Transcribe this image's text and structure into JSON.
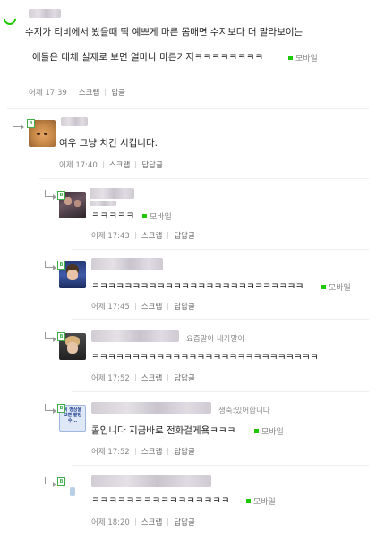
{
  "post": {
    "line1": "수지가 티비에서 봤을때 딱 예쁘게 마른 몸매면 수지보다 더 말라보이는",
    "line2": "애들은 대체 실제로 보면 얼마나 마른거지ㅋㅋㅋㅋㅋㅋㅋㅋ",
    "mobile": "모바일",
    "time": "어제 17:39",
    "scrap": "스크랩",
    "reply": "답글"
  },
  "comments": [
    {
      "text": "여우 그냥 치킨 시킵니다.",
      "time": "어제 17:40",
      "scrap": "스크랩",
      "reply": "답답글",
      "mobile": ""
    },
    {
      "text": "ㅋㅋㅋㅋㅋ",
      "time": "어제 17:43",
      "scrap": "스크랩",
      "reply": "답답글",
      "mobile": "모바일"
    },
    {
      "text": "ㅋㅋㅋㅋㅋㅋㅋㅋㅋㅋㅋㅋㅋㅋㅋㅋㅋㅋㅋㅋㅋㅋㅋㅋㅋㅋ",
      "time": "어제 17:45",
      "scrap": "스크랩",
      "reply": "답답글",
      "mobile": "모바일",
      "note": ""
    },
    {
      "text": "ㅋㅋㅋㅋㅋㅋㅋㅋㅋㅋㅋㅋㅋㅋㅋㅋㅋㅋㅋㅋㅋㅋㅋㅋㅋㅋㅋㅋ",
      "time": "어제 17:52",
      "scrap": "스크랩",
      "reply": "답답글",
      "mobile": "",
      "note": "요즘말아 내가말아"
    },
    {
      "text": "콜입니다 지금바로 전화걸게욬ㅋㅋㅋ",
      "time": "어제 17:52",
      "scrap": "스크랩",
      "reply": "답답글",
      "mobile": "모바일",
      "note": "생축:있어합니다",
      "avatar_text": "이 영상을 보면 팥빙수..."
    },
    {
      "text": "ㅋㅋㅋㅋㅋㅋㅋㅋㅋㅋㅋㅋㅋㅋㅋㅋ",
      "time": "어제 18:20",
      "scrap": "스크랩",
      "reply": "답답글",
      "mobile": "모바일"
    }
  ],
  "colors": {
    "accent": "#1ec800",
    "meta": "#888888"
  }
}
